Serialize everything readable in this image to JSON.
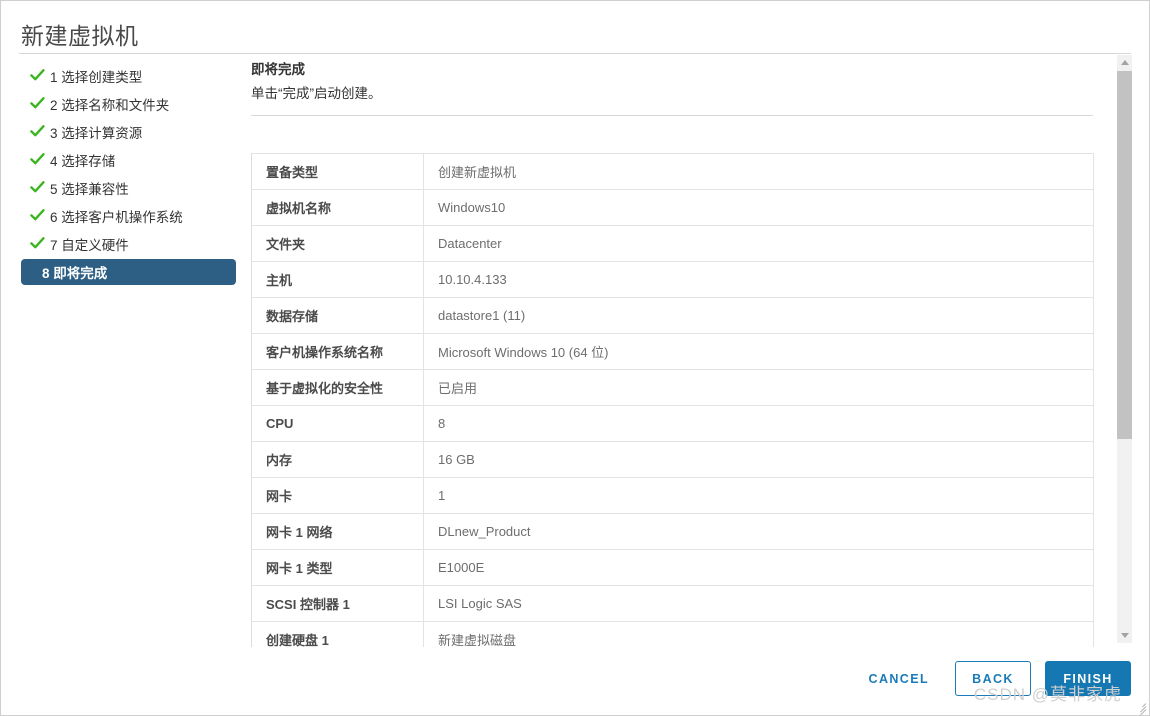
{
  "window": {
    "title": "新建虚拟机"
  },
  "steps": [
    {
      "num": "1",
      "label": "1 选择创建类型",
      "state": "done"
    },
    {
      "num": "2",
      "label": "2 选择名称和文件夹",
      "state": "done"
    },
    {
      "num": "3",
      "label": "3 选择计算资源",
      "state": "done"
    },
    {
      "num": "4",
      "label": "4 选择存储",
      "state": "done"
    },
    {
      "num": "5",
      "label": "5 选择兼容性",
      "state": "done"
    },
    {
      "num": "6",
      "label": "6 选择客户机操作系统",
      "state": "done"
    },
    {
      "num": "7",
      "label": "7 自定义硬件",
      "state": "done"
    },
    {
      "num": "8",
      "label": "8 即将完成",
      "state": "current"
    }
  ],
  "pane": {
    "title": "即将完成",
    "subtitle": "单击“完成”启动创建。"
  },
  "summary": {
    "rows": [
      {
        "key": "置备类型",
        "value": "创建新虚拟机"
      },
      {
        "key": "虚拟机名称",
        "value": "Windows10"
      },
      {
        "key": "文件夹",
        "value": "Datacenter"
      },
      {
        "key": "主机",
        "value": "10.10.4.133"
      },
      {
        "key": "数据存储",
        "value": "datastore1 (11)"
      },
      {
        "key": "客户机操作系统名称",
        "value": "Microsoft Windows 10 (64 位)"
      },
      {
        "key": "基于虚拟化的安全性",
        "value": "已启用"
      },
      {
        "key": "CPU",
        "value": "8"
      },
      {
        "key": "内存",
        "value": "16 GB"
      },
      {
        "key": "网卡",
        "value": "1"
      },
      {
        "key": "网卡 1 网络",
        "value": "DLnew_Product"
      },
      {
        "key": "网卡 1 类型",
        "value": "E1000E"
      },
      {
        "key": "SCSI 控制器 1",
        "value": "LSI Logic SAS"
      },
      {
        "key": "创建硬盘 1",
        "value": "新建虚拟磁盘"
      }
    ]
  },
  "footer": {
    "cancel_label": "CANCEL",
    "back_label": "BACK",
    "finish_label": "FINISH"
  },
  "watermark": {
    "text": "CSDN @莫非家虎"
  },
  "colors": {
    "current_step_bg": "#2d5f85",
    "check_green": "#3cb521",
    "primary_blue": "#1678b3",
    "link_blue": "#1b7bb9",
    "border_gray": "#e3e3e3"
  }
}
